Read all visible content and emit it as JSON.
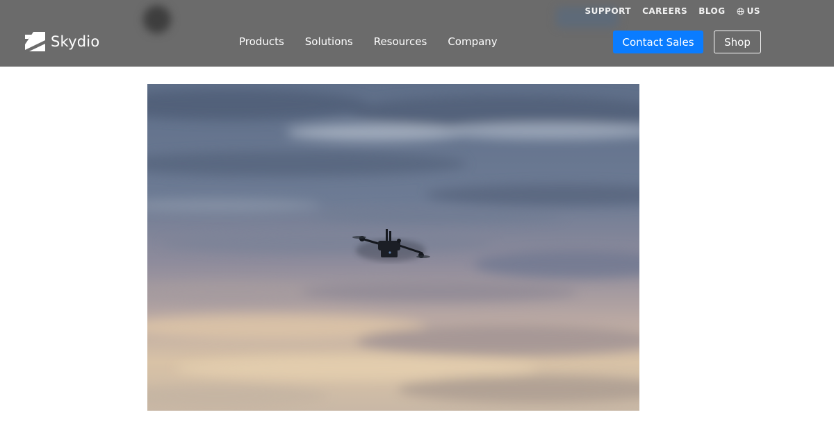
{
  "brand": {
    "name": "Skydio",
    "logo_icon": "skydio-logo-icon"
  },
  "utility_nav": {
    "support": "SUPPORT",
    "careers": "CAREERS",
    "blog": "BLOG",
    "region": "US",
    "region_icon": "globe-icon"
  },
  "main_nav": {
    "products": "Products",
    "solutions": "Solutions",
    "resources": "Resources",
    "company": "Company"
  },
  "actions": {
    "contact_sales": "Contact Sales",
    "shop": "Shop"
  },
  "colors": {
    "header_bg": "#6b6b6b",
    "accent_blue": "#0a7cff",
    "page_bg": "#ffffff"
  }
}
